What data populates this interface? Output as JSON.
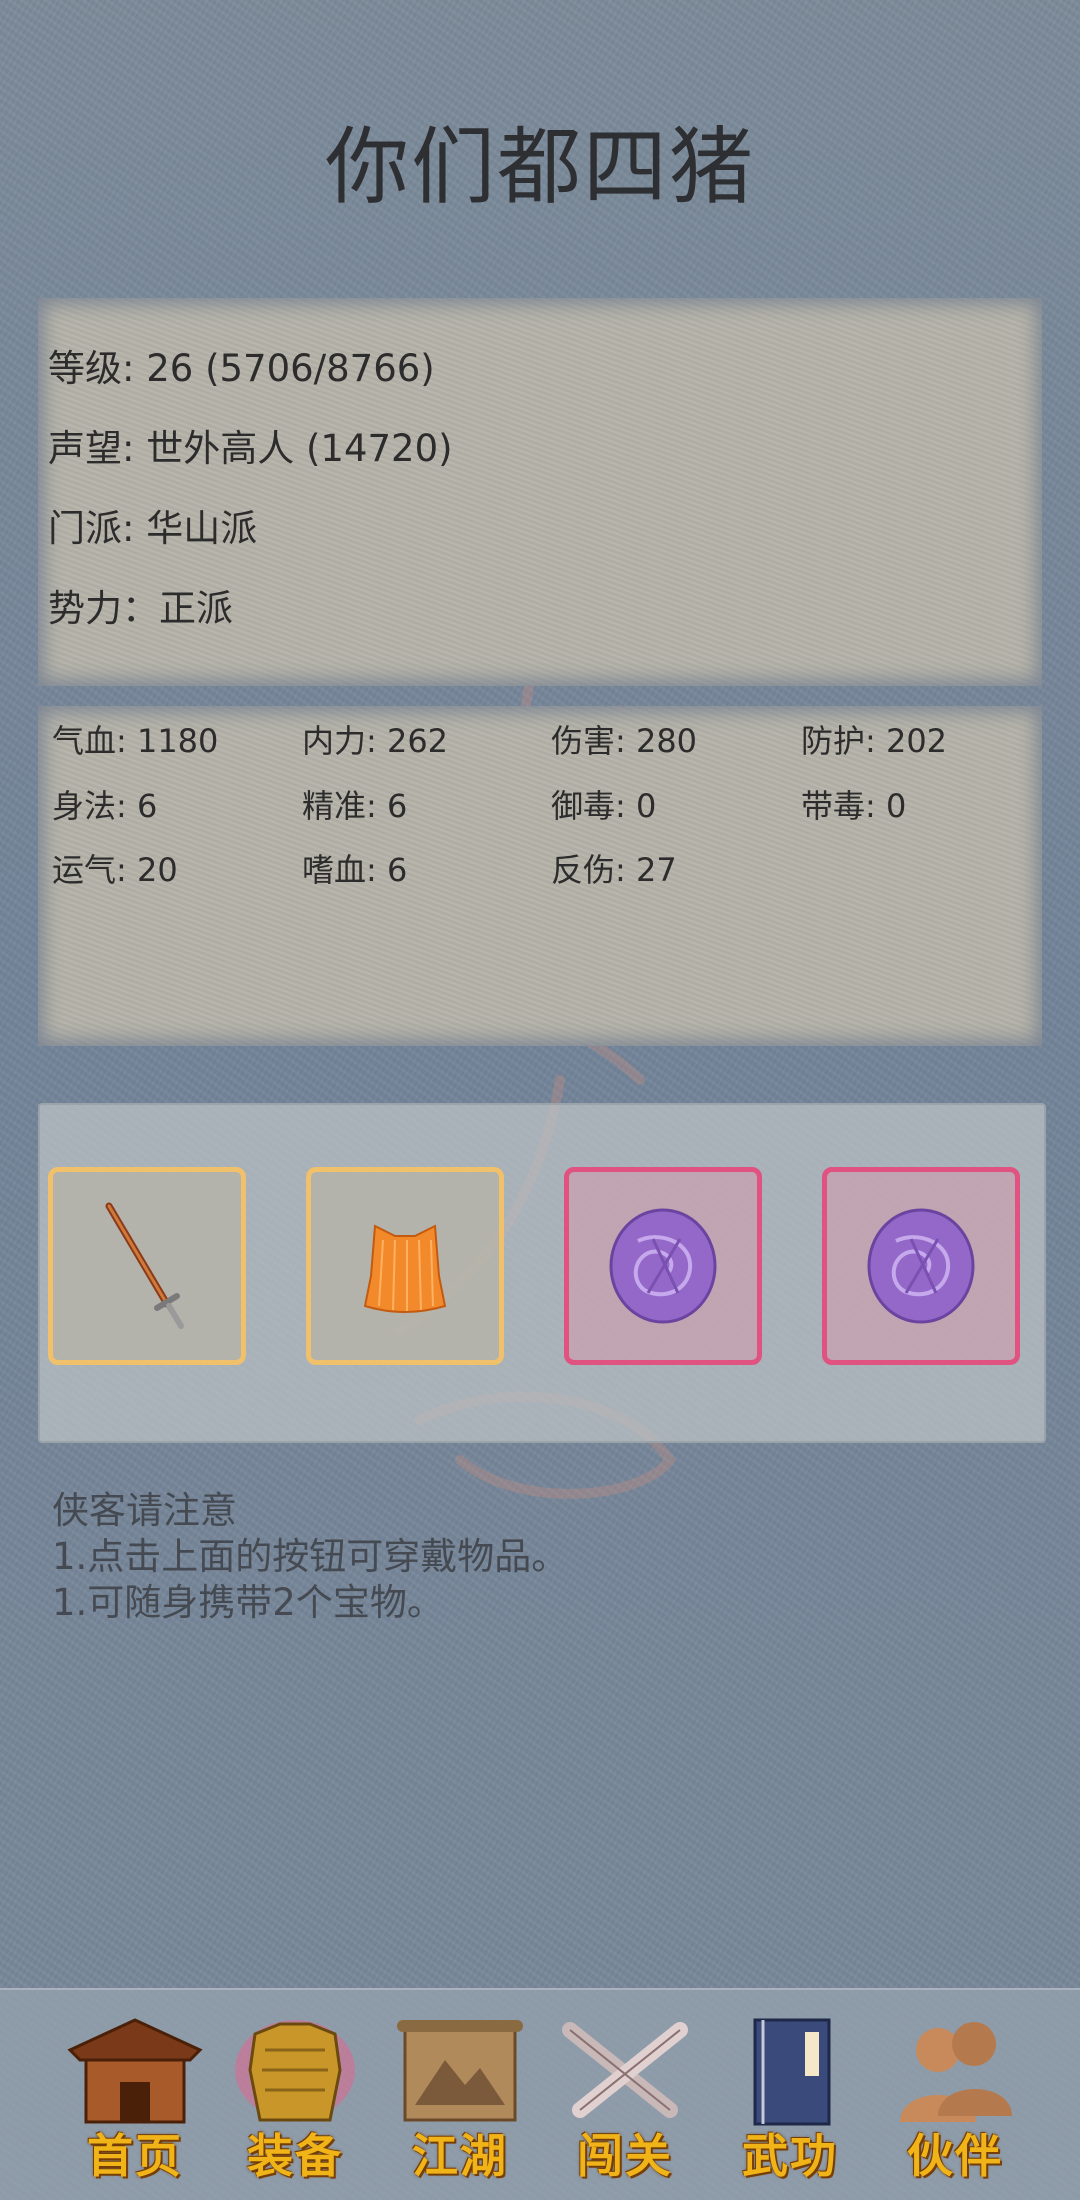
{
  "title": "你们都四猪",
  "info": {
    "level": "等级: 26 (5706/8766)",
    "reputation": "声望: 世外高人 (14720)",
    "sect": "门派: 华山派",
    "faction": "势力：正派"
  },
  "stats": [
    {
      "label": "气血: 1180"
    },
    {
      "label": "内力: 262"
    },
    {
      "label": "伤害: 280"
    },
    {
      "label": "防护: 202"
    },
    {
      "label": "身法: 6"
    },
    {
      "label": "精准: 6"
    },
    {
      "label": "御毒: 0"
    },
    {
      "label": "带毒: 0"
    },
    {
      "label": "运气: 20"
    },
    {
      "label": "嗜血: 6"
    },
    {
      "label": "反伤: 27"
    }
  ],
  "equipment": [
    {
      "icon": "sword-icon",
      "rarity_color": "#f0c06a"
    },
    {
      "icon": "orange-vest-icon",
      "rarity_color": "#f0c06a"
    },
    {
      "icon": "purple-treasure-icon",
      "rarity_color": "#e0527f"
    },
    {
      "icon": "purple-treasure-icon",
      "rarity_color": "#e0527f"
    }
  ],
  "notice": {
    "heading": "侠客请注意",
    "line1": "1.点击上面的按钮可穿戴物品。",
    "line2": "1.可随身携带2个宝物。"
  },
  "nav": [
    {
      "label": "首页",
      "icon": "house-icon"
    },
    {
      "label": "装备",
      "icon": "armor-icon"
    },
    {
      "label": "江湖",
      "icon": "scroll-map-icon"
    },
    {
      "label": "闯关",
      "icon": "crossed-swords-icon"
    },
    {
      "label": "武功",
      "icon": "martial-book-icon"
    },
    {
      "label": "伙伴",
      "icon": "companions-icon"
    }
  ]
}
